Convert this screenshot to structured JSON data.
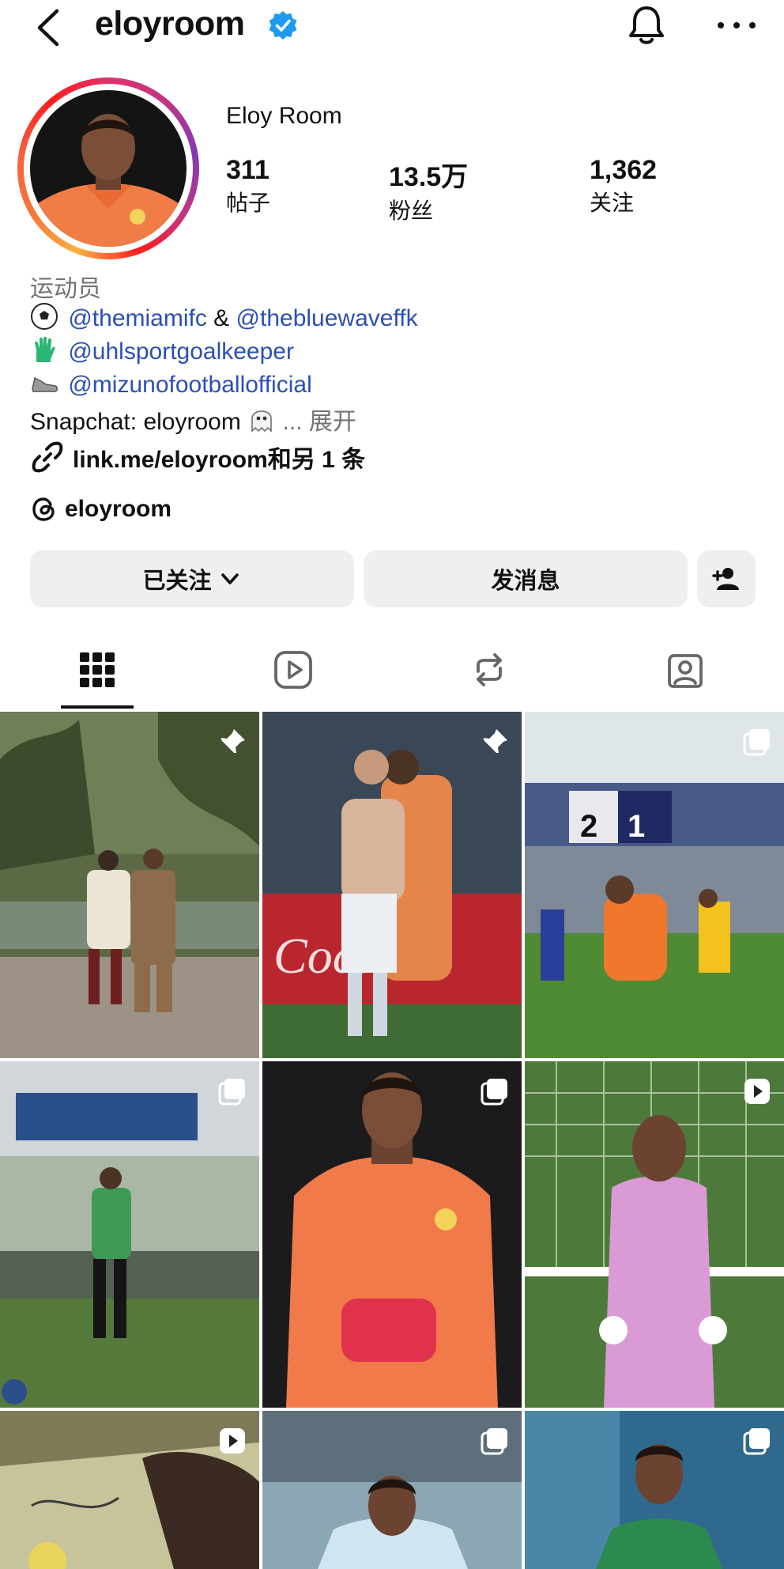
{
  "header": {
    "username": "eloyroom",
    "verified": true
  },
  "profile": {
    "display_name": "Eloy Room",
    "stats": [
      {
        "value": "311",
        "label": "帖子"
      },
      {
        "value": "13.5万",
        "label": "粉丝"
      },
      {
        "value": "1,362",
        "label": "关注"
      }
    ],
    "category": "运动员",
    "bio": {
      "line1_mention_a": "@themiamifc",
      "line1_joiner": " & ",
      "line1_mention_b": "@thebluewaveffk",
      "line2_mention": "@uhlsportgoalkeeper",
      "line3_mention": "@mizunofootballofficial",
      "line4_text": "Snapchat: eloyroom",
      "line4_more": "... 展开"
    },
    "link_text": "link.me/eloyroom和另 1 条",
    "threads_handle": "eloyroom"
  },
  "actions": {
    "following_label": "已关注",
    "message_label": "发消息"
  },
  "tabs": [
    "grid-icon",
    "reels-icon",
    "reposts-icon",
    "tagged-icon"
  ],
  "grid": [
    {
      "kind": "pinned",
      "scene": "couple-palms"
    },
    {
      "kind": "pinned",
      "scene": "hug-stadium"
    },
    {
      "kind": "carousel",
      "scene": "scoreboard",
      "score_home": "2",
      "score_away": "1"
    },
    {
      "kind": "carousel",
      "scene": "training-green"
    },
    {
      "kind": "carousel",
      "scene": "portrait-orange"
    },
    {
      "kind": "reel",
      "scene": "pink-kit-goal"
    },
    {
      "kind": "reel",
      "scene": "signing"
    },
    {
      "kind": "carousel",
      "scene": "portrait-lightblue"
    },
    {
      "kind": "carousel",
      "scene": "portrait-green"
    }
  ],
  "colors": {
    "mention": "#2c4fb3",
    "verified": "#1d9bf0",
    "button_bg": "#efefef"
  }
}
